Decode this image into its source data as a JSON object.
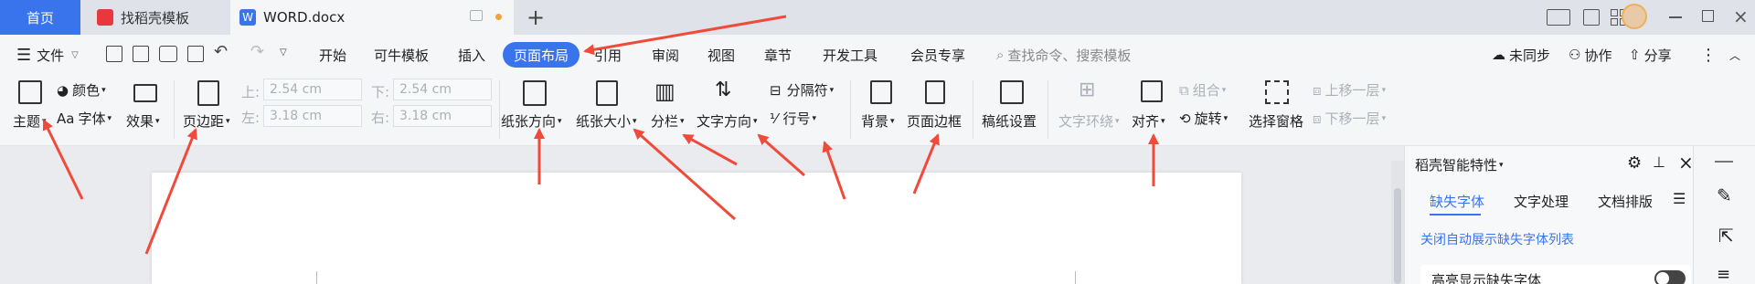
{
  "tabs": {
    "home": "首页",
    "template": "找稻壳模板",
    "word": "WORD.docx",
    "add": "+"
  },
  "menu": {
    "file": "文件",
    "items": [
      "开始",
      "可牛模板",
      "插入",
      "页面布局",
      "引用",
      "审阅",
      "视图",
      "章节",
      "开发工具",
      "会员专享"
    ],
    "search_placeholder": "查找命令、搜索模板",
    "sync": "未同步",
    "collab": "协作",
    "share": "分享"
  },
  "ribbon": {
    "theme": "主题",
    "color": "颜色",
    "font": "字体",
    "effect": "效果",
    "margin": "页边距",
    "top_label": "上:",
    "top_value": "2.54 cm",
    "bottom_label": "下:",
    "bottom_value": "2.54 cm",
    "left_label": "左:",
    "left_value": "3.18 cm",
    "right_label": "右:",
    "right_value": "3.18 cm",
    "orientation": "纸张方向",
    "size": "纸张大小",
    "columns": "分栏",
    "text_direction": "文字方向",
    "separator": "分隔符",
    "line_number": "行号",
    "background": "背景",
    "page_border": "页面边框",
    "grid_paper": "稿纸设置",
    "text_wrap": "文字环绕",
    "align": "对齐",
    "group": "组合",
    "rotate": "旋转",
    "selection_pane": "选择窗格",
    "bring_forward": "上移一层",
    "send_backward": "下移一层"
  },
  "panel": {
    "title": "稻壳智能特性",
    "tabs": [
      "缺失字体",
      "文字处理",
      "文档排版"
    ],
    "link": "关闭自动展示缺失字体列表",
    "option": "高亮显示缺失字体"
  },
  "colors": {
    "accent": "#3a74ec",
    "arrow": "#f04a3b"
  }
}
